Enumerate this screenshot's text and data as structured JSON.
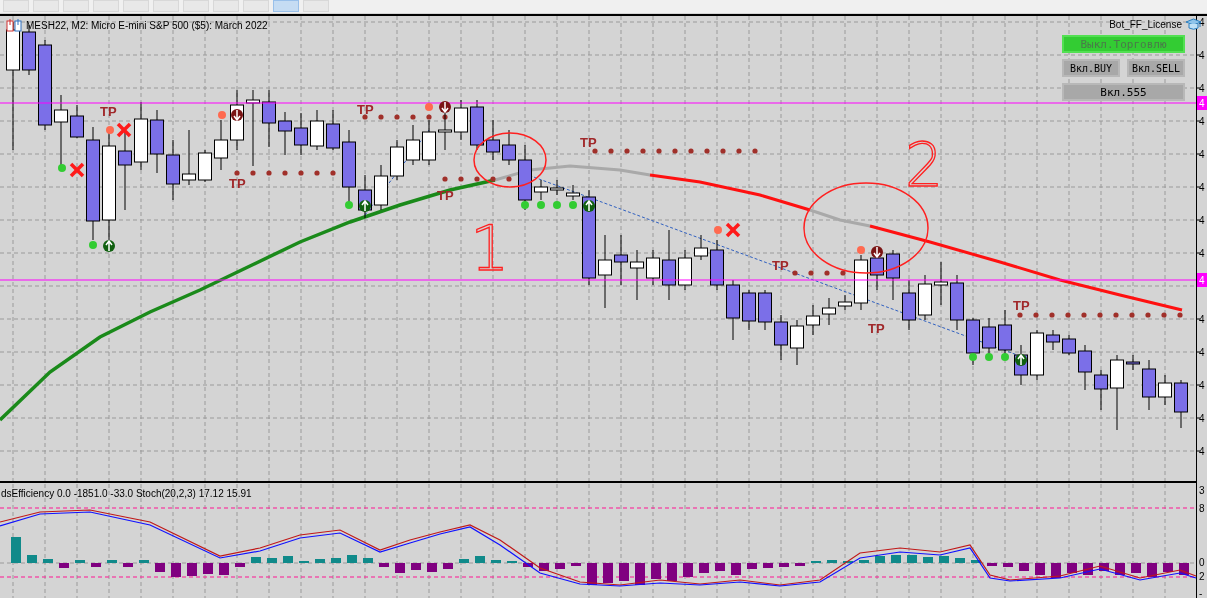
{
  "toolbar": {
    "timeframe_buttons": [
      {
        "selected": false
      },
      {
        "selected": false
      },
      {
        "selected": false
      },
      {
        "selected": false
      },
      {
        "selected": false
      },
      {
        "selected": false
      },
      {
        "selected": false
      },
      {
        "selected": false
      },
      {
        "selected": false
      },
      {
        "selected": true
      },
      {
        "selected": false
      }
    ]
  },
  "chart": {
    "title": "MESH22, M2:  Micro E-mini S&P 500 ($5): March 2022",
    "license": "Bot_FF_License",
    "buttons": [
      {
        "label": "Выкл.Торговлю",
        "on": true
      },
      {
        "label": "Вкл.BUY",
        "on": false
      },
      {
        "label": "Вкл.SELL",
        "on": false
      },
      {
        "label": "Вкл.555",
        "on": false
      }
    ],
    "tp_labels": [
      "TP",
      "TP",
      "TP",
      "TP",
      "TP",
      "TP",
      "TP",
      "TP"
    ],
    "annotations": [
      "1",
      "2"
    ],
    "price_axis_labels": [
      "4",
      "4",
      "4",
      "4",
      "4",
      "4",
      "4",
      "4",
      "4",
      "4",
      "4",
      "4",
      "4"
    ],
    "level_lines": [
      {
        "label": "4"
      },
      {
        "label": "4"
      }
    ]
  },
  "indicator": {
    "title": "dsEfficiency 0.0 -1851.0 -33.0 Stoch(20,2,3) 17.12 15.91",
    "axis_labels": [
      "3",
      "8",
      "0",
      "2",
      "-"
    ]
  }
}
